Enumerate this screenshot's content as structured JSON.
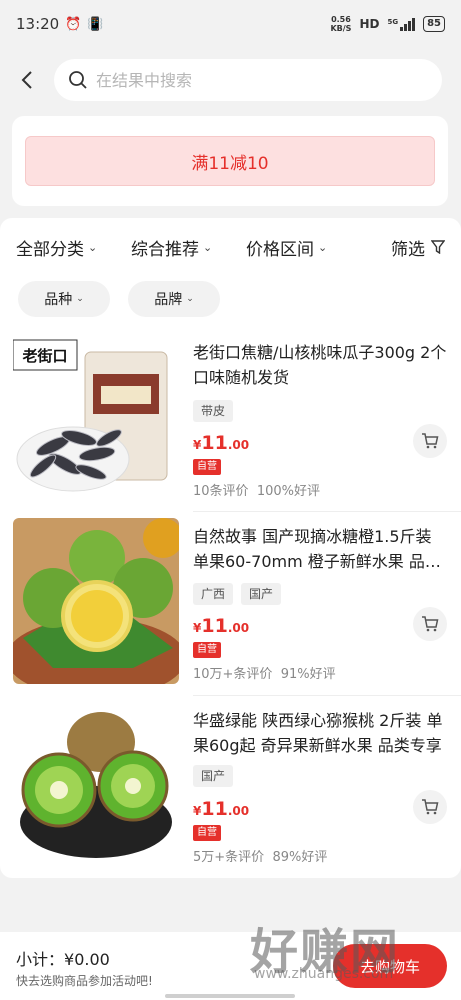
{
  "status_bar": {
    "time": "13:20",
    "net_speed_value": "0.56",
    "net_speed_unit": "KB/S",
    "hd": "HD",
    "signal_label": "5G",
    "battery": "85"
  },
  "search": {
    "placeholder": "在结果中搜索"
  },
  "promo": {
    "label": "满11减10"
  },
  "filters": [
    {
      "label": "全部分类"
    },
    {
      "label": "综合推荐"
    },
    {
      "label": "价格区间"
    },
    {
      "label": "筛选"
    }
  ],
  "chips": [
    {
      "label": "品种"
    },
    {
      "label": "品牌"
    }
  ],
  "products": [
    {
      "title": "老街口焦糖/山核桃味瓜子300g   2个口味随机发货",
      "tags": [
        "带皮"
      ],
      "price_symbol": "¥",
      "price_int": "11",
      "price_dec": ".00",
      "badge": "自营",
      "reviews": "10条评价",
      "rating": "100%好评",
      "brand_text": "老街口"
    },
    {
      "title": "自然故事  国产现摘冰糖橙1.5斤装 单果60-70mm 橙子新鲜水果 品…",
      "tags": [
        "广西",
        "国产"
      ],
      "price_symbol": "¥",
      "price_int": "11",
      "price_dec": ".00",
      "badge": "自营",
      "reviews": "10万+条评价",
      "rating": "91%好评"
    },
    {
      "title": "华盛绿能 陕西绿心猕猴桃 2斤装 单果60g起 奇异果新鲜水果 品类专享",
      "tags": [
        "国产"
      ],
      "price_symbol": "¥",
      "price_int": "11",
      "price_dec": ".00",
      "badge": "自营",
      "reviews": "5万+条评价",
      "rating": "89%好评"
    }
  ],
  "bottom": {
    "subtotal_label": "小计：",
    "subtotal_value": "¥0.00",
    "hint": "快去选购商品参加活动吧!",
    "cart_button": "去购物车"
  },
  "watermark": {
    "title": "好赚网",
    "url": "www.zhuanges.com"
  },
  "colors": {
    "accent": "#e5302b",
    "promo_bg": "#fde0e0",
    "page_bg": "#f2f2f2"
  }
}
